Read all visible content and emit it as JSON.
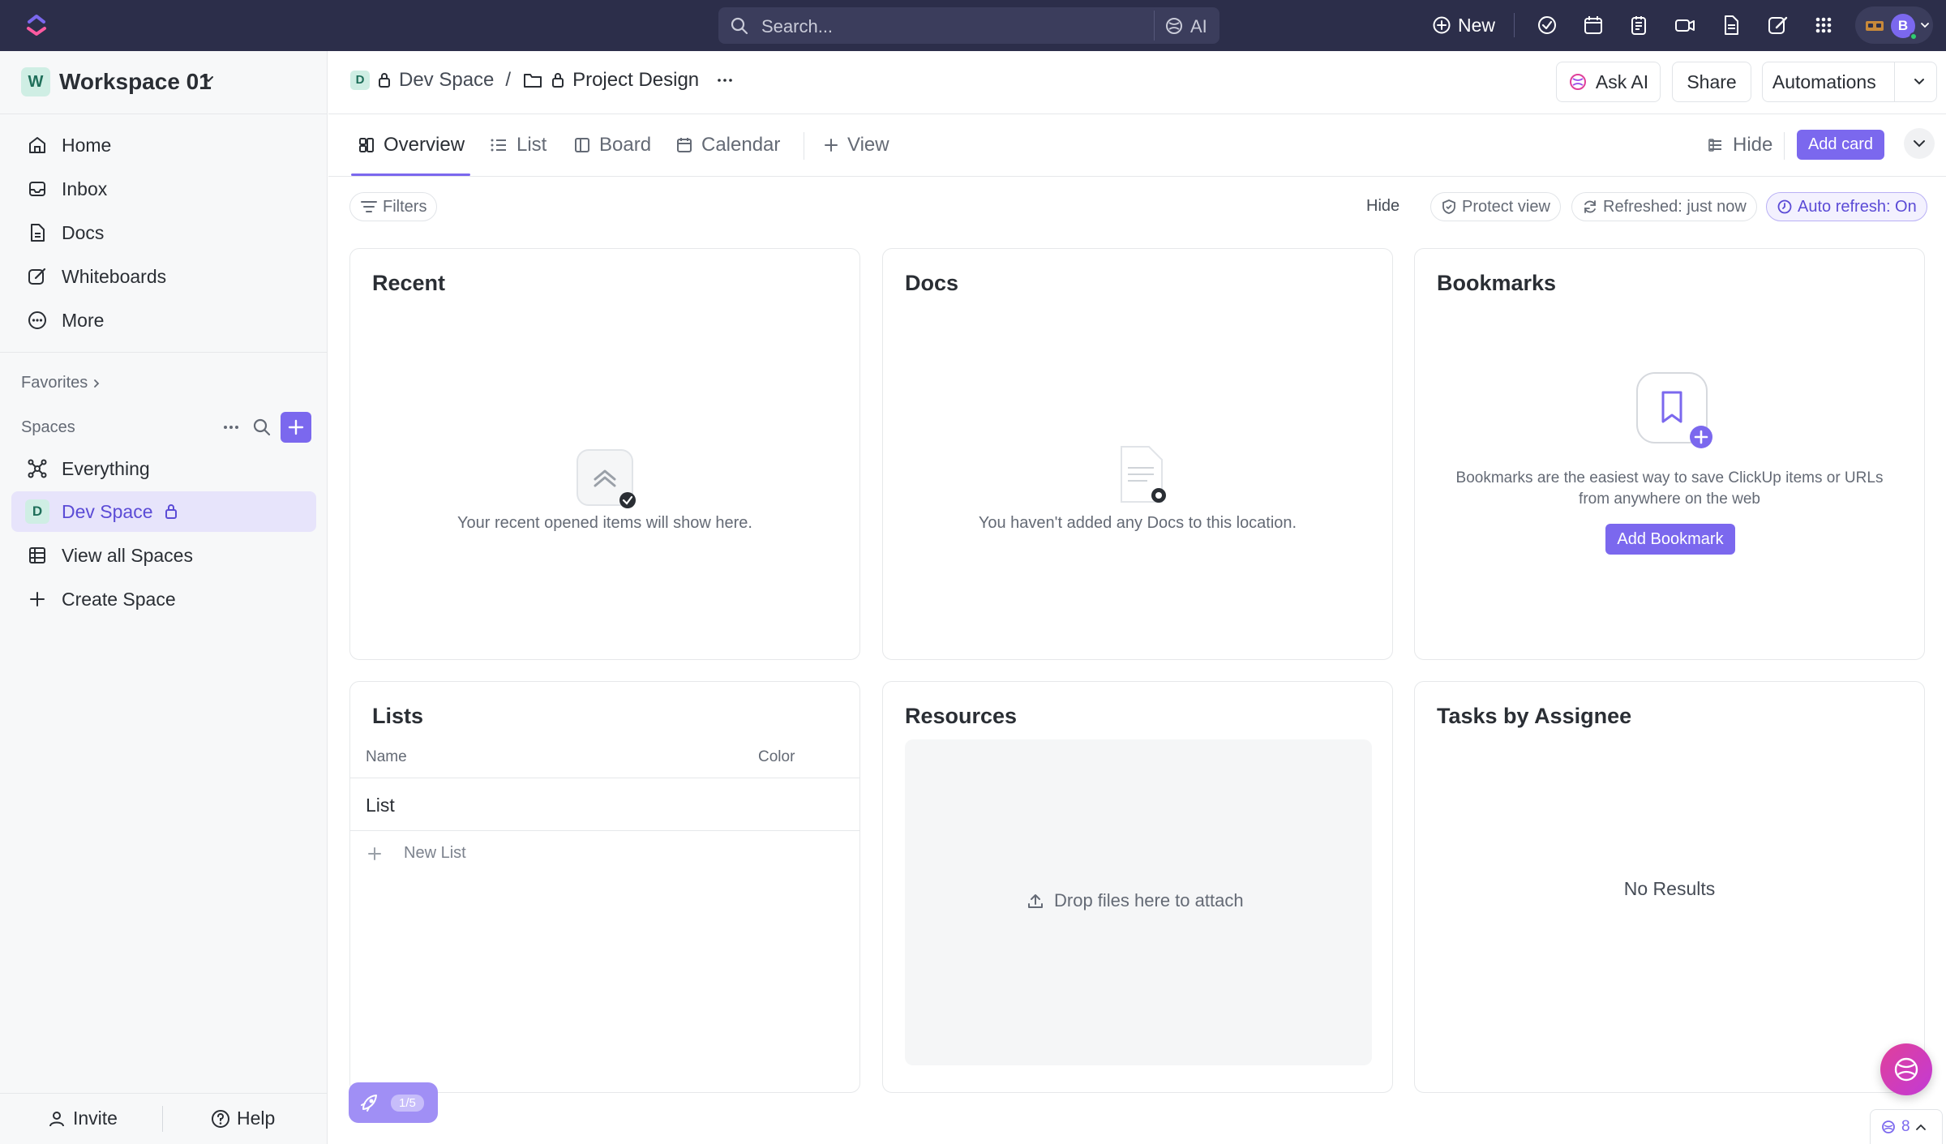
{
  "topbar": {
    "search_placeholder": "Search...",
    "ai_label": "AI",
    "new_label": "New",
    "avatar_initial": "B"
  },
  "sidebar": {
    "workspace_badge": "W",
    "workspace_name": "Workspace 01",
    "nav": [
      {
        "label": "Home",
        "icon": "home-icon"
      },
      {
        "label": "Inbox",
        "icon": "inbox-icon"
      },
      {
        "label": "Docs",
        "icon": "docs-icon"
      },
      {
        "label": "Whiteboards",
        "icon": "whiteboard-icon"
      },
      {
        "label": "More",
        "icon": "more-icon"
      }
    ],
    "favorites_label": "Favorites",
    "spaces_label": "Spaces",
    "spaces": [
      {
        "label": "Everything",
        "icon": "everything-icon"
      },
      {
        "label": "Dev Space",
        "badge": "D",
        "active": true
      },
      {
        "label": "View all Spaces",
        "icon": "grid-icon"
      },
      {
        "label": "Create Space",
        "icon": "plus-icon"
      }
    ],
    "invite_label": "Invite",
    "help_label": "Help"
  },
  "breadcrumb": {
    "space_badge": "D",
    "space": "Dev Space",
    "separator": "/",
    "folder": "Project Design"
  },
  "header_actions": {
    "ask_ai": "Ask AI",
    "share": "Share",
    "automations": "Automations"
  },
  "tabs": {
    "overview": "Overview",
    "list": "List",
    "board": "Board",
    "calendar": "Calendar",
    "add_view": "View",
    "hide": "Hide",
    "add_card": "Add card"
  },
  "filters": {
    "filters": "Filters",
    "hide": "Hide",
    "protect_view": "Protect view",
    "refreshed": "Refreshed: just now",
    "auto_refresh": "Auto refresh: On"
  },
  "cards": {
    "recent": {
      "title": "Recent",
      "empty": "Your recent opened items will show here."
    },
    "docs": {
      "title": "Docs",
      "empty": "You haven't added any Docs to this location."
    },
    "bookmarks": {
      "title": "Bookmarks",
      "empty_line1": "Bookmarks are the easiest way to save ClickUp items or URLs",
      "empty_line2": "from anywhere on the web",
      "button": "Add Bookmark"
    },
    "lists": {
      "title": "Lists",
      "col_name": "Name",
      "col_color": "Color",
      "row": "List",
      "new_list": "New List"
    },
    "resources": {
      "title": "Resources",
      "drop": "Drop files here to attach"
    },
    "tasks": {
      "title": "Tasks by Assignee",
      "empty": "No Results"
    }
  },
  "footer": {
    "onboarding_progress": "1/5",
    "notifications_count": "8"
  },
  "colors": {
    "accent": "#7b68ee",
    "topbar": "#2c2e4a",
    "ai_pink": "#e0409a"
  }
}
